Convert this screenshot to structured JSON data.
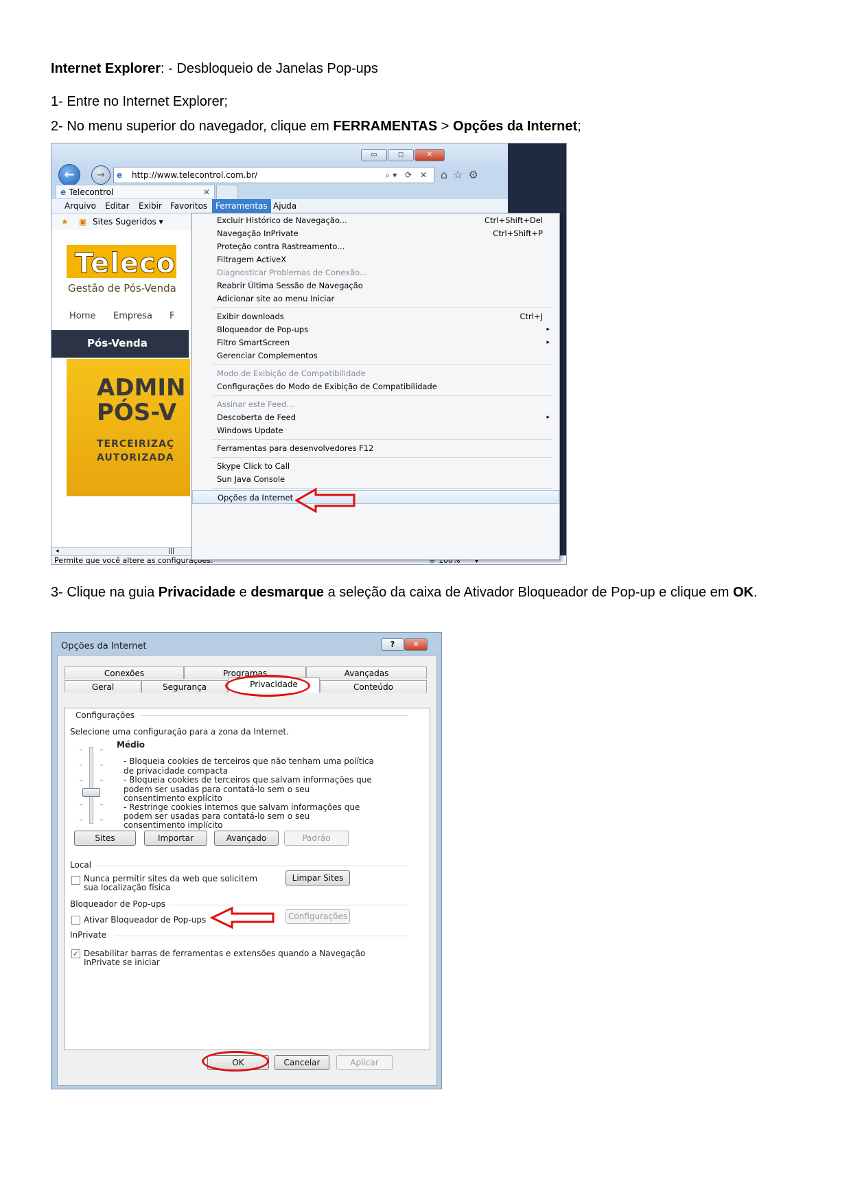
{
  "doc": {
    "title_bold": "Internet Explorer",
    "title_rest": ": - Desbloqueio de Janelas Pop-ups",
    "step1": "1- Entre no Internet Explorer;",
    "step2_a": "2- No menu superior do navegador, clique em ",
    "step2_b": "FERRAMENTAS",
    "step2_c": " > ",
    "step2_d": "Opções da Internet",
    "step2_e": ";",
    "step3_a": "3- Clique na guia ",
    "step3_b": "Privacidade",
    "step3_c": " e ",
    "step3_d": "desmarque",
    "step3_e": " a seleção da caixa de Ativador Bloqueador de Pop-up e clique em ",
    "step3_f": "OK",
    "step3_g": "."
  },
  "ie": {
    "url": "http://www.telecontrol.com.br/",
    "tab_title": "Telecontrol",
    "menu": [
      "Arquivo",
      "Editar",
      "Exibir",
      "Favoritos",
      "Ferramentas",
      "Ajuda"
    ],
    "fav_label": "Sites Sugeridos ▾",
    "web": {
      "logo": "Teleco",
      "subtitle": "Gestão de Pós-Venda",
      "nav_home": "Home",
      "nav_empresa": "Empresa",
      "nav_f": "F",
      "bar_label": "Pós-Venda",
      "banner1": "ADMIN",
      "banner2": "PÓS-V",
      "banner3": "TERCEIRIZAÇ",
      "banner4": "AUTORIZADA"
    },
    "tools_menu": [
      {
        "label": "Excluir Histórico de Navegação...",
        "shortcut": "Ctrl+Shift+Del"
      },
      {
        "label": "Navegação InPrivate",
        "shortcut": "Ctrl+Shift+P"
      },
      {
        "label": "Proteção contra Rastreamento..."
      },
      {
        "label": "Filtragem ActiveX"
      },
      {
        "label": "Diagnosticar Problemas de Conexão...",
        "disabled": true
      },
      {
        "label": "Reabrir Última Sessão de Navegação"
      },
      {
        "label": "Adicionar site ao menu Iniciar"
      },
      {
        "label": "Exibir downloads",
        "shortcut": "Ctrl+J"
      },
      {
        "label": "Bloqueador de Pop-ups",
        "submenu": true
      },
      {
        "label": "Filtro SmartScreen",
        "submenu": true
      },
      {
        "label": "Gerenciar Complementos"
      },
      {
        "label": "Modo de Exibição de Compatibilidade",
        "disabled": true
      },
      {
        "label": "Configurações do Modo de Exibição de Compatibilidade"
      },
      {
        "label": "Assinar este Feed...",
        "disabled": true
      },
      {
        "label": "Descoberta de Feed",
        "submenu": true
      },
      {
        "label": "Windows Update"
      },
      {
        "label": "Ferramentas para desenvolvedores F12"
      },
      {
        "label": "Skype Click to Call"
      },
      {
        "label": "Sun Java Console"
      },
      {
        "label": "Opções da Internet"
      }
    ],
    "status_text": "Permite que você altere as configurações.",
    "zoom": "100%"
  },
  "dialog": {
    "title": "Opções da Internet",
    "help": "?",
    "tabs_row1": [
      "Conexões",
      "Programas",
      "Avançadas"
    ],
    "tabs_row2": [
      "Geral",
      "Segurança",
      "Privacidade",
      "Conteúdo"
    ],
    "config_label": "Configurações",
    "select_text": "Selecione uma configuração para a zona da Internet.",
    "level": "Médio",
    "desc": [
      "- Bloqueia cookies de terceiros que não tenham uma política",
      "de privacidade compacta",
      "- Bloqueia cookies de terceiros que salvam informações que",
      "podem ser usadas para contatá-lo sem o seu",
      "consentimento explícito",
      "- Restringe cookies internos que salvam informações que",
      "podem ser usadas para contatá-lo sem o seu",
      "consentimento implícito"
    ],
    "btn_sites": "Sites",
    "btn_importar": "Importar",
    "btn_avancado": "Avançado",
    "btn_padrao": "Padrão",
    "local_label": "Local",
    "local_text1": "Nunca permitir sites da web que solicitem",
    "local_text2": "sua localização física",
    "btn_limpar": "Limpar Sites",
    "popup_label": "Bloqueador de Pop-ups",
    "popup_text": "Ativar Bloqueador de Pop-ups",
    "btn_config": "Configurações",
    "inprivate_label": "InPrivate",
    "inprivate_text1": "Desabilitar barras de ferramentas e extensões quando a Navegação",
    "inprivate_text2": "InPrivate se iniciar",
    "btn_ok": "OK",
    "btn_cancelar": "Cancelar",
    "btn_aplicar": "Aplicar"
  },
  "colors": {
    "annotation_red": "#e01010",
    "menu_highlight": "#3c7fd0",
    "logo_yellow": "#f4b400"
  }
}
